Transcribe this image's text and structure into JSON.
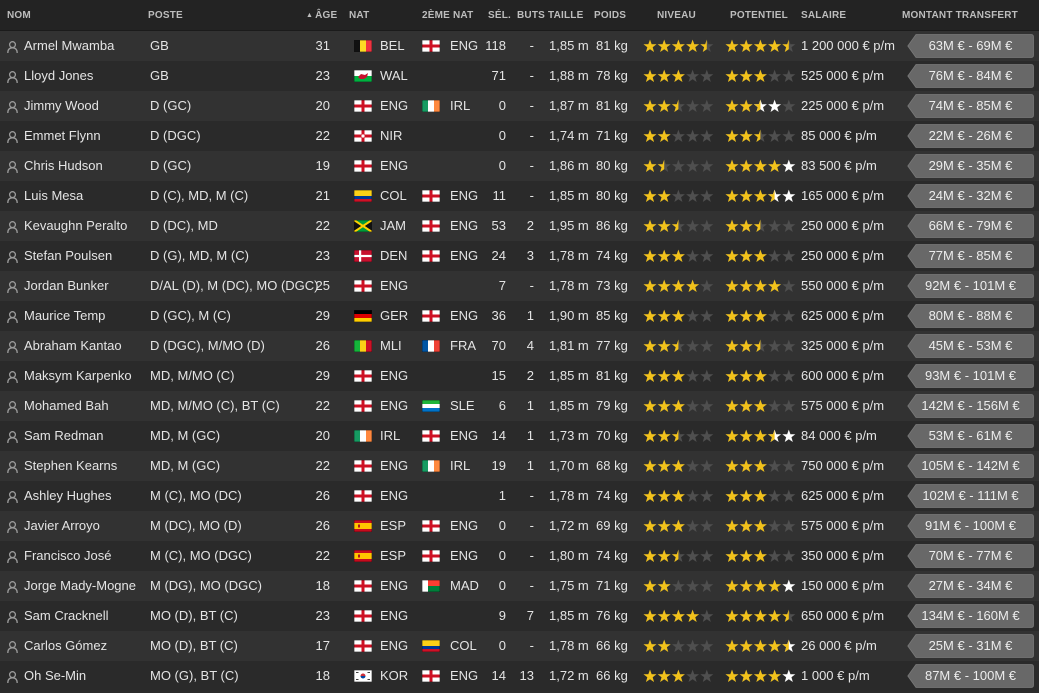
{
  "header": {
    "name": "NOM",
    "position": "POSTE",
    "age": "ÂGE",
    "nat": "NAT",
    "nat2": "2ÈME NAT",
    "caps": "SÉL.",
    "goals": "BUTS",
    "height": "TAILLE",
    "weight": "POIDS",
    "ability": "NIVEAU",
    "potential": "POTENTIEL",
    "salary": "SALAIRE",
    "transfer": "MONTANT TRANSFERT"
  },
  "colors": {
    "star": "#f2c21b",
    "star_empty": "#4f4f4f",
    "star_potential_bright": "#ffffff",
    "tag_bg": "#686868",
    "header_bg": "#232323",
    "row_odd": "#323232",
    "row_even": "#2a2a2a"
  },
  "players": [
    {
      "name": "Armel Mwamba",
      "position": "GB",
      "age": "31",
      "flag1": "BEL",
      "nat": "BEL",
      "flag2": "ENG",
      "nat2": "ENG",
      "caps": "118",
      "goals": "-",
      "height": "1,85 m",
      "weight": "81 kg",
      "ability": 4.5,
      "potential": 4.5,
      "potential_max": false,
      "salary": "1 200 000 € p/m",
      "transfer": "63M € - 69M €"
    },
    {
      "name": "Lloyd Jones",
      "position": "GB",
      "age": "23",
      "flag1": "WAL",
      "nat": "WAL",
      "flag2": "",
      "nat2": "",
      "caps": "71",
      "goals": "-",
      "height": "1,88 m",
      "weight": "78 kg",
      "ability": 3,
      "potential": 3,
      "potential_max": false,
      "salary": "525 000 € p/m",
      "transfer": "76M € - 84M €"
    },
    {
      "name": "Jimmy Wood",
      "position": "D (GC)",
      "age": "20",
      "flag1": "ENG",
      "nat": "ENG",
      "flag2": "IRL",
      "nat2": "IRL",
      "caps": "0",
      "goals": "-",
      "height": "1,87 m",
      "weight": "81 kg",
      "ability": 2.5,
      "potential": 2.5,
      "potential_max": true,
      "salary": "225 000 € p/m",
      "transfer": "74M € - 85M €"
    },
    {
      "name": "Emmet Flynn",
      "position": "D (DGC)",
      "age": "22",
      "flag1": "NIR",
      "nat": "NIR",
      "flag2": "",
      "nat2": "",
      "caps": "0",
      "goals": "-",
      "height": "1,74 m",
      "weight": "71 kg",
      "ability": 2,
      "potential": 2.5,
      "potential_max": false,
      "salary": "85 000 € p/m",
      "transfer": "22M € - 26M €"
    },
    {
      "name": "Chris Hudson",
      "position": "D (GC)",
      "age": "19",
      "flag1": "ENG",
      "nat": "ENG",
      "flag2": "",
      "nat2": "",
      "caps": "0",
      "goals": "-",
      "height": "1,86 m",
      "weight": "80 kg",
      "ability": 1.5,
      "potential": 4,
      "potential_max": true,
      "salary": "83 500 € p/m",
      "transfer": "29M € - 35M €"
    },
    {
      "name": "Luis Mesa",
      "position": "D (C), MD, M (C)",
      "age": "21",
      "flag1": "COL",
      "nat": "COL",
      "flag2": "ENG",
      "nat2": "ENG",
      "caps": "11",
      "goals": "-",
      "height": "1,85 m",
      "weight": "80 kg",
      "ability": 2,
      "potential": 3.5,
      "potential_max": true,
      "salary": "165 000 € p/m",
      "transfer": "24M € - 32M €"
    },
    {
      "name": "Kevaughn Peralto",
      "position": "D (DC), MD",
      "age": "22",
      "flag1": "JAM",
      "nat": "JAM",
      "flag2": "ENG",
      "nat2": "ENG",
      "caps": "53",
      "goals": "2",
      "height": "1,95 m",
      "weight": "86 kg",
      "ability": 2.5,
      "potential": 2.5,
      "potential_max": false,
      "salary": "250 000 € p/m",
      "transfer": "66M € - 79M €"
    },
    {
      "name": "Stefan Poulsen",
      "position": "D (G), MD, M (C)",
      "age": "23",
      "flag1": "DEN",
      "nat": "DEN",
      "flag2": "ENG",
      "nat2": "ENG",
      "caps": "24",
      "goals": "3",
      "height": "1,78 m",
      "weight": "74 kg",
      "ability": 3,
      "potential": 3,
      "potential_max": false,
      "salary": "250 000 € p/m",
      "transfer": "77M € - 85M €"
    },
    {
      "name": "Jordan Bunker",
      "position": "D/AL (D), M (DC), MO (DGC)",
      "age": "25",
      "flag1": "ENG",
      "nat": "ENG",
      "flag2": "",
      "nat2": "",
      "caps": "7",
      "goals": "-",
      "height": "1,78 m",
      "weight": "73 kg",
      "ability": 4,
      "potential": 4,
      "potential_max": false,
      "salary": "550 000 € p/m",
      "transfer": "92M € - 101M €"
    },
    {
      "name": "Maurice Temp",
      "position": "D (GC), M (C)",
      "age": "29",
      "flag1": "GER",
      "nat": "GER",
      "flag2": "ENG",
      "nat2": "ENG",
      "caps": "36",
      "goals": "1",
      "height": "1,90 m",
      "weight": "85 kg",
      "ability": 3,
      "potential": 3,
      "potential_max": false,
      "salary": "625 000 € p/m",
      "transfer": "80M € - 88M €"
    },
    {
      "name": "Abraham Kantao",
      "position": "D (DGC), M/MO (D)",
      "age": "26",
      "flag1": "MLI",
      "nat": "MLI",
      "flag2": "FRA",
      "nat2": "FRA",
      "caps": "70",
      "goals": "4",
      "height": "1,81 m",
      "weight": "77 kg",
      "ability": 2.5,
      "potential": 2.5,
      "potential_max": false,
      "salary": "325 000 € p/m",
      "transfer": "45M € - 53M €"
    },
    {
      "name": "Maksym Karpenko",
      "position": "MD, M/MO (C)",
      "age": "29",
      "flag1": "ENG",
      "nat": "ENG",
      "flag2": "",
      "nat2": "",
      "caps": "15",
      "goals": "2",
      "height": "1,85 m",
      "weight": "81 kg",
      "ability": 3,
      "potential": 3,
      "potential_max": false,
      "salary": "600 000 € p/m",
      "transfer": "93M € - 101M €"
    },
    {
      "name": "Mohamed Bah",
      "position": "MD, M/MO (C), BT (C)",
      "age": "22",
      "flag1": "ENG",
      "nat": "ENG",
      "flag2": "SLE",
      "nat2": "SLE",
      "caps": "6",
      "goals": "1",
      "height": "1,85 m",
      "weight": "79 kg",
      "ability": 3,
      "potential": 3,
      "potential_max": false,
      "salary": "575 000 € p/m",
      "transfer": "142M € - 156M €"
    },
    {
      "name": "Sam Redman",
      "position": "MD, M (GC)",
      "age": "20",
      "flag1": "IRL",
      "nat": "IRL",
      "flag2": "ENG",
      "nat2": "ENG",
      "caps": "14",
      "goals": "1",
      "height": "1,73 m",
      "weight": "70 kg",
      "ability": 2.5,
      "potential": 3.5,
      "potential_max": true,
      "salary": "84 000 € p/m",
      "transfer": "53M € - 61M €"
    },
    {
      "name": "Stephen Kearns",
      "position": "MD, M (GC)",
      "age": "22",
      "flag1": "ENG",
      "nat": "ENG",
      "flag2": "IRL",
      "nat2": "IRL",
      "caps": "19",
      "goals": "1",
      "height": "1,70 m",
      "weight": "68 kg",
      "ability": 3,
      "potential": 3,
      "potential_max": false,
      "salary": "750 000 € p/m",
      "transfer": "105M € - 142M €"
    },
    {
      "name": "Ashley Hughes",
      "position": "M (C), MO (DC)",
      "age": "26",
      "flag1": "ENG",
      "nat": "ENG",
      "flag2": "",
      "nat2": "",
      "caps": "1",
      "goals": "-",
      "height": "1,78 m",
      "weight": "74 kg",
      "ability": 3,
      "potential": 3,
      "potential_max": false,
      "salary": "625 000 € p/m",
      "transfer": "102M € - 111M €"
    },
    {
      "name": "Javier Arroyo",
      "position": "M (DC), MO (D)",
      "age": "26",
      "flag1": "ESP",
      "nat": "ESP",
      "flag2": "ENG",
      "nat2": "ENG",
      "caps": "0",
      "goals": "-",
      "height": "1,72 m",
      "weight": "69 kg",
      "ability": 3,
      "potential": 3,
      "potential_max": false,
      "salary": "575 000 € p/m",
      "transfer": "91M € - 100M €"
    },
    {
      "name": "Francisco José",
      "position": "M (C), MO (DGC)",
      "age": "22",
      "flag1": "ESP",
      "nat": "ESP",
      "flag2": "ENG",
      "nat2": "ENG",
      "caps": "0",
      "goals": "-",
      "height": "1,80 m",
      "weight": "74 kg",
      "ability": 2.5,
      "potential": 3,
      "potential_max": false,
      "salary": "350 000 € p/m",
      "transfer": "70M € - 77M €"
    },
    {
      "name": "Jorge Mady-Mogne",
      "position": "M (DG), MO (DGC)",
      "age": "18",
      "flag1": "ENG",
      "nat": "ENG",
      "flag2": "MAD",
      "nat2": "MAD",
      "caps": "0",
      "goals": "-",
      "height": "1,75 m",
      "weight": "71 kg",
      "ability": 2,
      "potential": 4,
      "potential_max": true,
      "salary": "150 000 € p/m",
      "transfer": "27M € - 34M €"
    },
    {
      "name": "Sam Cracknell",
      "position": "MO (D), BT (C)",
      "age": "23",
      "flag1": "ENG",
      "nat": "ENG",
      "flag2": "",
      "nat2": "",
      "caps": "9",
      "goals": "7",
      "height": "1,85 m",
      "weight": "76 kg",
      "ability": 4,
      "potential": 4.5,
      "potential_max": false,
      "salary": "650 000 € p/m",
      "transfer": "134M € - 160M €"
    },
    {
      "name": "Carlos Gómez",
      "position": "MO (D), BT (C)",
      "age": "17",
      "flag1": "ENG",
      "nat": "ENG",
      "flag2": "COL",
      "nat2": "COL",
      "caps": "0",
      "goals": "-",
      "height": "1,78 m",
      "weight": "66 kg",
      "ability": 2,
      "potential": 4.5,
      "potential_max": true,
      "salary": "26 000 € p/m",
      "transfer": "25M € - 31M €"
    },
    {
      "name": "Oh Se-Min",
      "position": "MO (G), BT (C)",
      "age": "18",
      "flag1": "KOR",
      "nat": "KOR",
      "flag2": "ENG",
      "nat2": "ENG",
      "caps": "14",
      "goals": "13",
      "height": "1,72 m",
      "weight": "66 kg",
      "ability": 3,
      "potential": 4,
      "potential_max": true,
      "salary": "1 000 € p/m",
      "transfer": "87M € - 100M €"
    }
  ]
}
